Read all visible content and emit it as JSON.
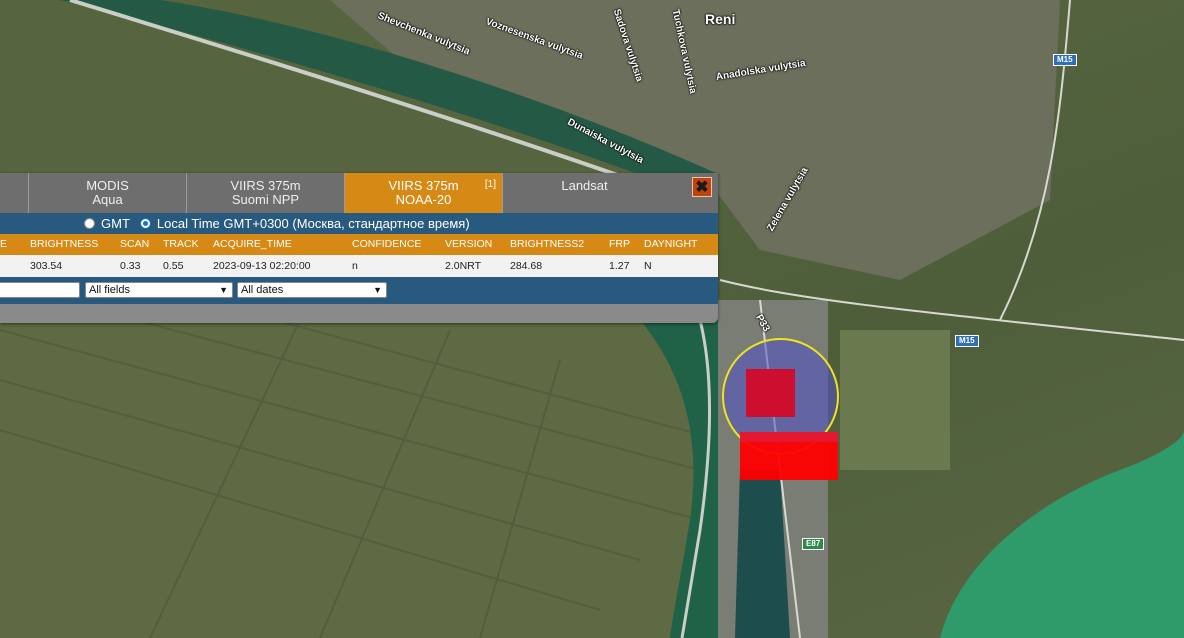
{
  "map": {
    "labels": {
      "city": "Reni",
      "street1": "Voznesenska vulytsia",
      "street2": "Shevchenka vulytsia",
      "street3": "Dunaiska vulytsia",
      "street4": "Anadolska vulytsia",
      "street5": "Zelena vulytsia",
      "street6": "Sadova vulytsia",
      "street7": "Tuchkova vulytsia",
      "road_p33": "P33"
    },
    "shields": {
      "m15_top": "M15",
      "m15_right": "M15",
      "e87": "E87"
    }
  },
  "panel": {
    "tabs": [
      {
        "label1": "",
        "label2": ""
      },
      {
        "label1": "MODIS",
        "label2": "Aqua"
      },
      {
        "label1": "VIIRS 375m",
        "label2": "Suomi NPP"
      },
      {
        "label1": "VIIRS 375m",
        "label2": "NOAA-20",
        "count": "[1]"
      },
      {
        "label1": "Landsat",
        "label2": ""
      }
    ],
    "close_glyph": "✖",
    "timezone": {
      "gmt_label": "GMT",
      "local_label": "Local Time GMT+0300 (Москва, стандартное время)"
    },
    "table": {
      "headers": [
        "E",
        "BRIGHTNESS",
        "SCAN",
        "TRACK",
        "ACQUIRE_TIME",
        "CONFIDENCE",
        "VERSION",
        "BRIGHTNESS2",
        "FRP",
        "DAYNIGHT"
      ],
      "rows": [
        [
          "",
          "303.54",
          "0.33",
          "0.55",
          "2023-09-13 02:20:00",
          "n",
          "2.0NRT",
          "284.68",
          "1.27",
          "N"
        ]
      ]
    },
    "filter": {
      "input_value": "",
      "fields_select": "All fields",
      "dates_select": "All dates"
    }
  },
  "colors": {
    "accent_orange": "#d68a15",
    "bar_blue": "#285a80",
    "fire_circle_border": "#f2e21b",
    "fire_red": "#ff0000"
  }
}
